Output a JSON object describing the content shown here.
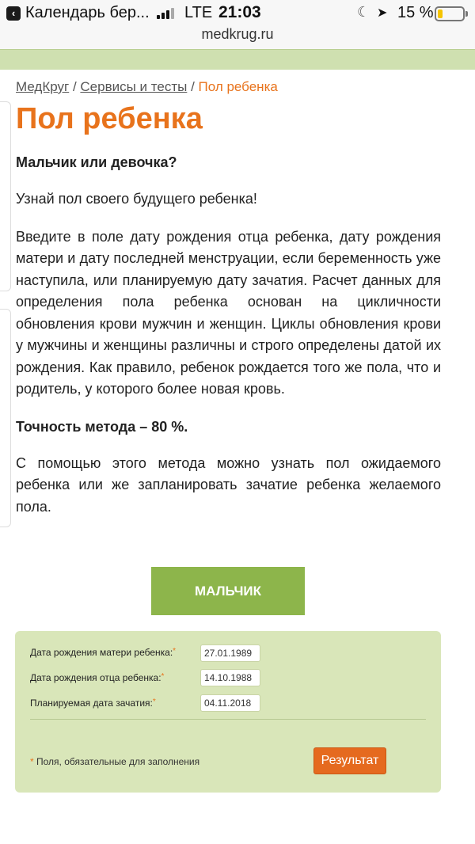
{
  "status_bar": {
    "back_app": "Календарь бер...",
    "network": "LTE",
    "time": "21:03",
    "battery": "15 %"
  },
  "browser": {
    "url": "medkrug.ru"
  },
  "breadcrumb": {
    "home": "МедКруг",
    "sep1": " / ",
    "section": "Сервисы и тесты",
    "sep2": " / ",
    "current": "Пол ребенка"
  },
  "page": {
    "title": "Пол ребенка",
    "lead": "Мальчик или девочка?",
    "p1": "Узнай пол своего будущего ребенка!",
    "p2": "Введите в поле дату рождения отца ребенка, дату рождения матери и дату последней менструации, если беременность уже наступила, или планируемую дату зачатия. Расчет данных для определения пола ребенка основан на цикличности обновления крови мужчин и женщин. Циклы обновления крови у мужчины и женщины различны и строго определены датой их рождения. Как правило, ребенок рождается того же пола, что и родитель, у которого более новая кровь.",
    "accuracy": "Точность метода – 80 %.",
    "p3": "С помощью этого метода можно узнать пол ожидаемого ребенка или же запланировать зачатие ребенка желаемого пола."
  },
  "result": {
    "label": "МАЛЬЧИК"
  },
  "form": {
    "mother_label": "Дата рождения матери ребенка:",
    "mother_value": "27.01.1989",
    "father_label": "Дата рождения отца ребенка:",
    "father_value": "14.10.1988",
    "conception_label": "Планируемая дата зачатия:",
    "conception_value": "04.11.2018",
    "required_mark": "*",
    "note": " Поля, обязательные для заполнения",
    "submit_label": "Результат"
  },
  "colors": {
    "accent_orange": "#e8731c",
    "result_green": "#8db54b",
    "form_bg": "#d9e6b9"
  }
}
